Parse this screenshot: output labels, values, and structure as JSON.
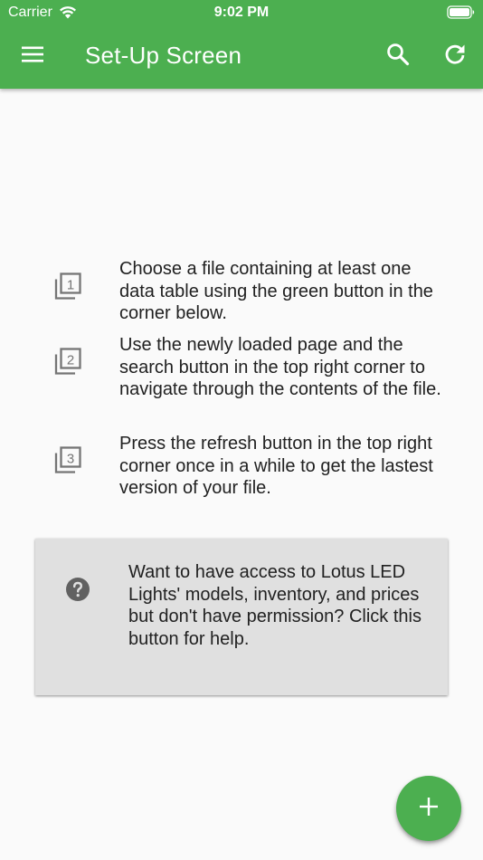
{
  "status_bar": {
    "carrier": "Carrier",
    "time": "9:02 PM"
  },
  "app_bar": {
    "title": "Set-Up Screen",
    "color": "#4caf50",
    "icons": [
      "menu-icon",
      "search-icon",
      "refresh-icon"
    ]
  },
  "steps": [
    {
      "number": "1",
      "icon": "filter-1-icon",
      "text": "Choose a file containing at least one data table using the green button in the corner below."
    },
    {
      "number": "2",
      "icon": "filter-2-icon",
      "text": "Use the newly loaded page and the search button in the top right corner to navigate through the contents of the file."
    },
    {
      "number": "3",
      "icon": "filter-3-icon",
      "text": "Press the refresh button in the top right corner once in a while to get the lastest version of your file."
    }
  ],
  "help_card": {
    "icon": "help-circle-icon",
    "text": "Want to have access to Lotus LED Lights' models, inventory, and prices but don't have permission? Click this button for help.",
    "background": "#e0e0e0"
  },
  "fab": {
    "icon": "add-icon",
    "color": "#4caf50"
  }
}
